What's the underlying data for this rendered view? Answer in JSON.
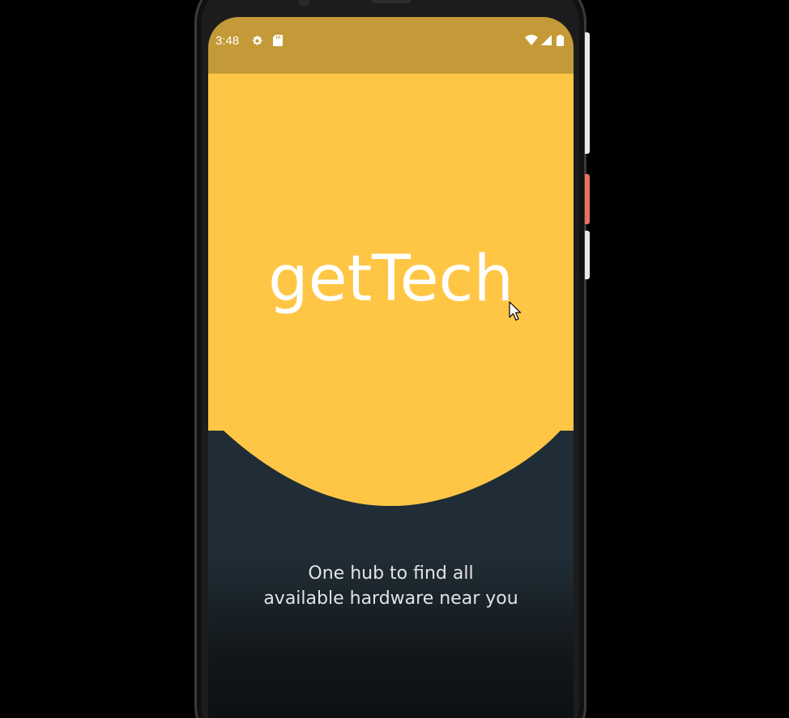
{
  "status_bar": {
    "time": "3:48",
    "left_icons": [
      "settings-icon",
      "sd-card-icon"
    ],
    "right_icons": [
      "wifi-icon",
      "cellular-signal-icon",
      "battery-icon"
    ]
  },
  "splash": {
    "app_name": "getTech",
    "tagline_line1": "One hub to find all",
    "tagline_line2": "available hardware near you"
  },
  "colors": {
    "status_bar": "#c39a37",
    "hero": "#ffc646",
    "background": "#202d36",
    "title_text": "#ffffff",
    "tagline_text": "#e3e3e3",
    "phone_side_accent": "#e8715a"
  }
}
